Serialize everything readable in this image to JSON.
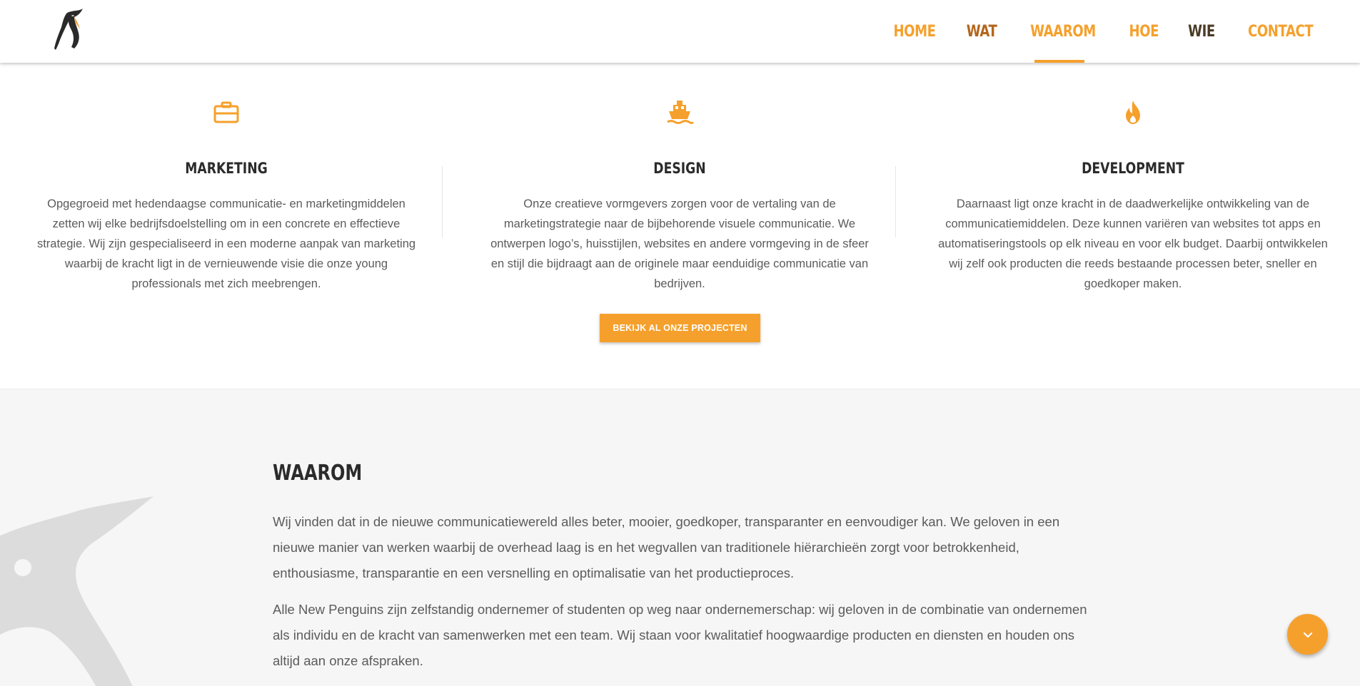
{
  "nav": {
    "items": [
      {
        "label": "HOME"
      },
      {
        "label": "WAT"
      },
      {
        "label": "WAAROM"
      },
      {
        "label": "HOE"
      },
      {
        "label": "WIE"
      },
      {
        "label": "CONTACT"
      }
    ],
    "active_index": 1
  },
  "services": [
    {
      "icon": "briefcase-icon",
      "title": "MARKETING",
      "text": "Opgegroeid met hedendaagse communicatie- en marketingmiddelen zetten wij elke bedrijfsdoelstelling om in een concrete en effectieve strategie. Wij zijn gespecialiseerd in een moderne aanpak van marketing waarbij de kracht ligt in de vernieuwende visie die onze young professionals met zich meebrengen."
    },
    {
      "icon": "ship-icon",
      "title": "DESIGN",
      "text": "Onze creatieve vormgevers zorgen voor de vertaling van de marketingstrategie naar de bijbehorende visuele communicatie. We ontwerpen logo’s, huisstijlen, websites en andere vormgeving in de sfeer en stijl die bijdraagt aan de originele maar eenduidige communicatie van bedrijven."
    },
    {
      "icon": "fire-icon",
      "title": "DEVELOPMENT",
      "text": "Daarnaast ligt onze kracht in de daadwerkelijke ontwikkeling van de communicatiemiddelen. Deze kunnen variëren van websites tot apps en automatiseringstools op elk niveau en voor elk budget. Daarbij ontwikkelen wij zelf ook producten die reeds bestaande processen beter, sneller en goedkoper maken."
    }
  ],
  "projects_button": "BEKIJK AL ONZE PROJECTEN",
  "why": {
    "title": "WAAROM",
    "paragraph1": "Wij vinden dat in de nieuwe communicatiewereld alles beter, mooier, goedkoper, transparanter en eenvoudiger kan. We geloven in een nieuwe manier van werken waarbij de overhead laag is en het wegvallen van traditionele hiërarchieën zorgt voor betrokkenheid, enthousiasme, transparantie en een versnelling en optimalisatie van het productieproces.",
    "paragraph2": "Alle New Penguins zijn zelfstandig ondernemer of studenten op weg naar ondernemerschap: wij geloven in de combinatie van ondernemen als individu en de kracht van samenwerken met een team. Wij staan voor kwalitatief hoogwaardige producten en diensten en houden ons altijd aan onze afspraken."
  },
  "colors": {
    "accent": "#f5a02c",
    "active_nav": "#b3661c",
    "dark_nav": "#4a3b25",
    "section_bg": "#f6f6f6"
  },
  "icons": {
    "logo": "penguin-logo",
    "scroll": "chevron-down-icon"
  }
}
